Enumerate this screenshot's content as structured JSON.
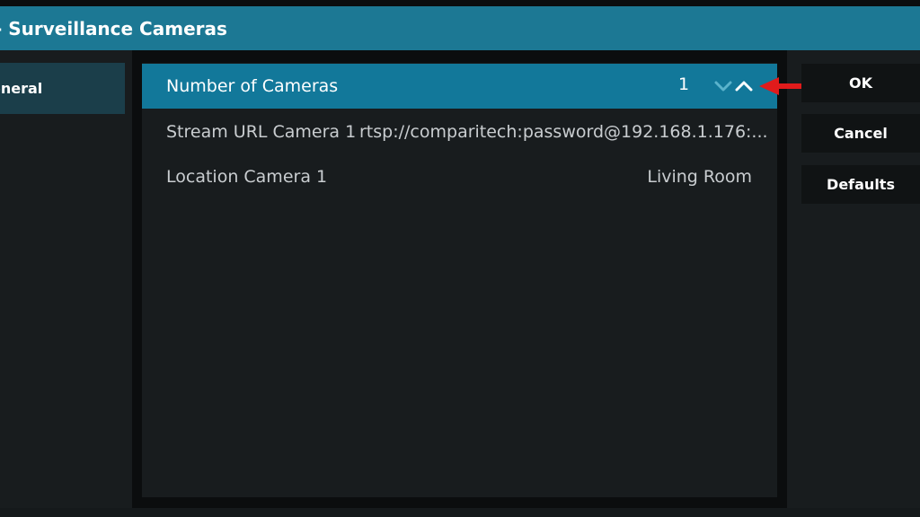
{
  "header": {
    "title": "- Surveillance Cameras"
  },
  "sidebar": {
    "items": [
      {
        "label": "eneral"
      }
    ]
  },
  "settings": [
    {
      "label": "Number of Cameras",
      "value": "1"
    },
    {
      "label": "Stream URL Camera 1",
      "value": "rtsp://comparitech:password@192.168.1.176:..."
    },
    {
      "label": "Location Camera 1",
      "value": "Living Room"
    }
  ],
  "buttons": {
    "ok": "OK",
    "cancel": "Cancel",
    "defaults": "Defaults"
  },
  "icons": {
    "spinner_down": "chevron-down-icon",
    "spinner_up": "chevron-up-icon",
    "annotation": "red-arrow-icon"
  },
  "colors": {
    "accent": "#1c7894",
    "selected_row": "#12789a",
    "annotation_arrow": "#e01b1b"
  }
}
